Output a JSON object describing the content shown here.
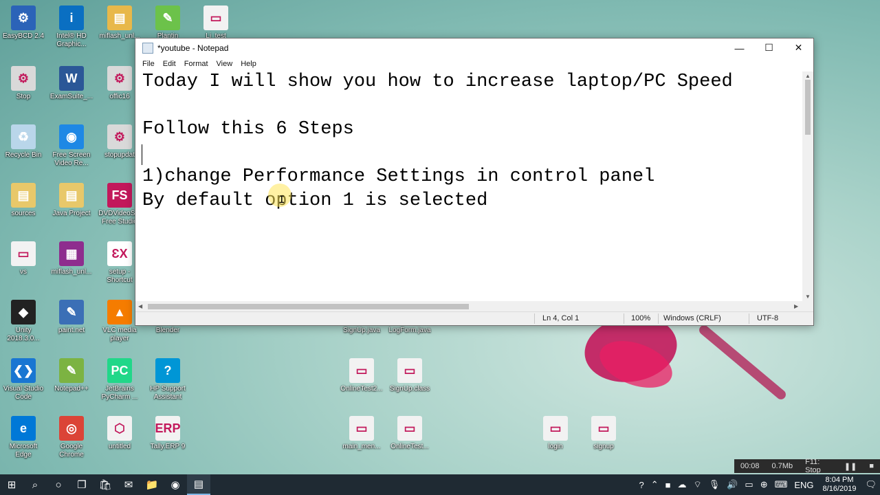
{
  "desktop": {
    "icons": [
      {
        "label": "EasyBCD 2.4",
        "color": "#2b63b8",
        "glyph": "⚙"
      },
      {
        "label": "Intel® HD\nGraphic...",
        "color": "#0a6fc2",
        "glyph": "i"
      },
      {
        "label": "miflash_unl...",
        "color": "#e8b84a",
        "glyph": "▤"
      },
      {
        "label": "Plantin",
        "color": "#6cc24a",
        "glyph": "✎"
      },
      {
        "label": "Li_test",
        "color": "#f2f2f2",
        "glyph": "▭"
      },
      {
        "label": "Stop",
        "color": "#d9d9d9",
        "glyph": "⚙"
      },
      {
        "label": "ExamSuite_...",
        "color": "#2b5797",
        "glyph": "W"
      },
      {
        "label": "offic16",
        "color": "#d9d9d9",
        "glyph": "⚙"
      },
      {
        "label": "Recycle Bin",
        "color": "#b9d6ea",
        "glyph": "♻"
      },
      {
        "label": "Free Screen\nVideo Re...",
        "color": "#1e88e5",
        "glyph": "◉"
      },
      {
        "label": "stopupdat",
        "color": "#d9d9d9",
        "glyph": "⚙"
      },
      {
        "label": "sources",
        "color": "#e8c86a",
        "glyph": "▤"
      },
      {
        "label": "Java Project",
        "color": "#e8c86a",
        "glyph": "▤"
      },
      {
        "label": "DVDVideoS...\nFree Studio",
        "color": "#c2185b",
        "glyph": "FS"
      },
      {
        "label": "vs",
        "color": "#f2f2f2",
        "glyph": "▭"
      },
      {
        "label": "miflash_unl...",
        "color": "#8e2d8e",
        "glyph": "▦"
      },
      {
        "label": "setup -\nShortcut",
        "color": "#ffffff",
        "glyph": "ƐX"
      },
      {
        "label": "Unity\n2018.3.0...",
        "color": "#222222",
        "glyph": "◆"
      },
      {
        "label": "paint.net",
        "color": "#3b6fb6",
        "glyph": "✎"
      },
      {
        "label": "VLC media\nplayer",
        "color": "#f57c00",
        "glyph": "▲"
      },
      {
        "label": "Blender",
        "color": "#e87d0d",
        "glyph": "◐"
      },
      {
        "label": "Visual Studio\nCode",
        "color": "#1976d2",
        "glyph": "❮❯"
      },
      {
        "label": "Notepad++",
        "color": "#7cb342",
        "glyph": "✎"
      },
      {
        "label": "JetBrains\nPyCharm ...",
        "color": "#21d789",
        "glyph": "PC"
      },
      {
        "label": "HP Support\nAssistant",
        "color": "#0096d6",
        "glyph": "?"
      },
      {
        "label": "Microsoft\nEdge",
        "color": "#0078d7",
        "glyph": "e"
      },
      {
        "label": "Google\nChrome",
        "color": "#db4437",
        "glyph": "◎"
      },
      {
        "label": "untitled",
        "color": "#f2f2f2",
        "glyph": "⬡"
      },
      {
        "label": "Tally.ERP 9",
        "color": "#f2f2f2",
        "glyph": "ERP"
      },
      {
        "label": "SignUp.java",
        "color": "#f2f2f2",
        "glyph": "▭"
      },
      {
        "label": "LogForm.java",
        "color": "#f2f2f2",
        "glyph": "▭"
      },
      {
        "label": "OnlineTest2...",
        "color": "#f2f2f2",
        "glyph": "▭"
      },
      {
        "label": "SignUp.class",
        "color": "#f2f2f2",
        "glyph": "▭"
      },
      {
        "label": "main_men...",
        "color": "#f2f2f2",
        "glyph": "▭"
      },
      {
        "label": "OnlineTest...",
        "color": "#f2f2f2",
        "glyph": "▭"
      },
      {
        "label": "login",
        "color": "#f2f2f2",
        "glyph": "▭"
      },
      {
        "label": "signup",
        "color": "#f2f2f2",
        "glyph": "▭"
      }
    ]
  },
  "notepad": {
    "title": "*youtube - Notepad",
    "menu": [
      "File",
      "Edit",
      "Format",
      "View",
      "Help"
    ],
    "lines": [
      "Today I will show you how to increase laptop/PC Speed",
      "",
      "Follow this 6 Steps",
      "",
      "1)change Performance Settings in control panel",
      "By default option 1 is selected"
    ],
    "status": {
      "position": "Ln 4, Col 1",
      "zoom": "100%",
      "line_ending": "Windows (CRLF)",
      "encoding": "UTF-8"
    }
  },
  "recorder": {
    "time": "00:08",
    "size": "0.7Mb",
    "stop_hint": "F11: Stop"
  },
  "taskbar": {
    "language": "ENG",
    "time": "8:04 PM",
    "date": "8/16/2019"
  }
}
